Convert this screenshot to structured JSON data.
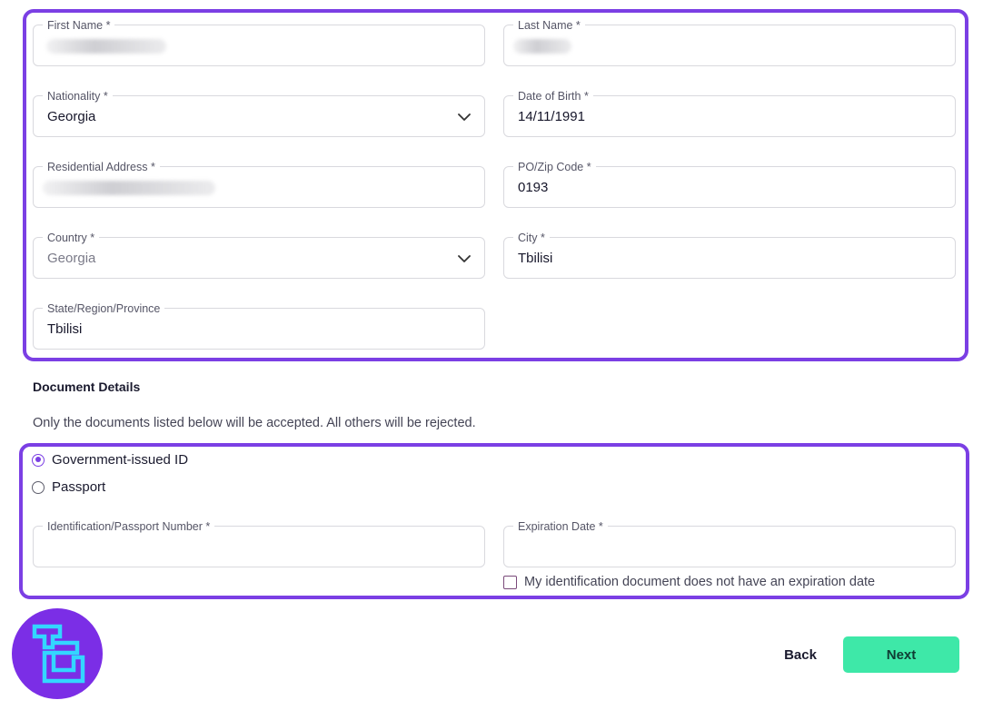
{
  "form": {
    "first_name": {
      "label": "First Name *"
    },
    "last_name": {
      "label": "Last Name *"
    },
    "nationality": {
      "label": "Nationality *",
      "value": "Georgia"
    },
    "date_of_birth": {
      "label": "Date of Birth *",
      "value": "14/11/1991"
    },
    "residential_address": {
      "label": "Residential Address *"
    },
    "zip_code": {
      "label": "PO/Zip Code *",
      "value": "0193"
    },
    "country": {
      "label": "Country *",
      "value": "Georgia"
    },
    "city": {
      "label": "City *",
      "value": "Tbilisi"
    },
    "state": {
      "label": "State/Region/Province",
      "value": "Tbilisi"
    }
  },
  "document": {
    "title": "Document Details",
    "note": "Only the documents listed below will be accepted. All others will be rejected.",
    "options": [
      {
        "label": "Government-issued ID",
        "selected": true
      },
      {
        "label": "Passport",
        "selected": false
      }
    ],
    "id_number": {
      "label": "Identification/Passport Number *",
      "value": ""
    },
    "expiration": {
      "label": "Expiration Date *",
      "value": ""
    },
    "no_expiry": {
      "label": "My identification document does not have an expiration date",
      "checked": false
    }
  },
  "actions": {
    "back": "Back",
    "next": "Next"
  },
  "colors": {
    "highlight": "#7b3fe4",
    "next_button": "#3ee8a8",
    "logo_bg": "#7b2ee6",
    "logo_mark": "#33d6ff"
  },
  "icons": {
    "select_arrow": "chevron-down-icon",
    "logo": "tc-logo"
  }
}
